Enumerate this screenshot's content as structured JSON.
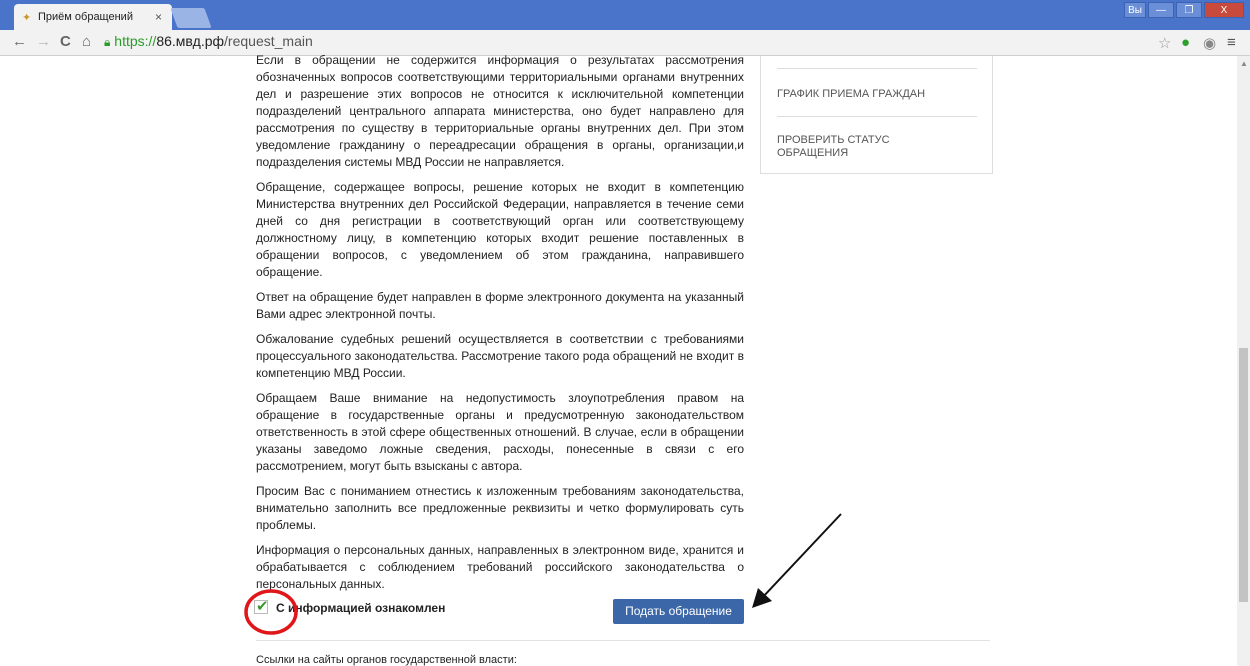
{
  "browser": {
    "tab_title": "Приём обращений",
    "tab_close": "×",
    "url_https": "https://",
    "url_host": "86.мвд.рф",
    "url_path": "/request_main",
    "window_user": "Вы",
    "minimize": "—",
    "restore": "❐",
    "close": "X"
  },
  "sidebar": {
    "link_schedule": "ГРАФИК ПРИЕМА ГРАЖДАН",
    "link_status_1": "ПРОВЕРИТЬ СТАТУС",
    "link_status_2": "ОБРАЩЕНИЯ"
  },
  "content": {
    "p1": "Если в обращении не содержится информация о результатах рассмотрения обозначенных вопросов соответствующими территориальными органами внутренних дел и разрешение этих вопросов не относится к исключительной компетенции подразделений центрального аппарата министерства, оно будет направлено для рассмотрения по существу в территориальные органы внутренних дел. При этом уведомление гражданину о переадресации обращения в органы, организации,и подразделения системы МВД России не направляется.",
    "p2": "Обращение, содержащее вопросы, решение которых не входит в компетенцию Министерства внутренних дел Российской Федерации, направляется в течение семи дней со дня регистрации в соответствующий орган или соответствующему должностному лицу, в компетенцию которых входит решение поставленных в обращении вопросов, с уведомлением об этом гражданина, направившего обращение.",
    "p3": "Ответ на обращение будет направлен в форме электронного документа на указанный Вами адрес электронной почты.",
    "p4": "Обжалование судебных решений осуществляется в соответствии с требованиями процессуального законодательства. Рассмотрение такого рода обращений не входит в компетенцию МВД России.",
    "p5": "Обращаем Ваше внимание на недопустимость злоупотребления правом на обращение в государственные органы и предусмотренную законодательством ответственность в этой сфере общественных отношений. В случае, если в обращении указаны заведомо ложные сведения, расходы, понесенные в связи с его рассмотрением, могут быть взысканы с автора.",
    "p6": "Просим Вас с пониманием отнестись к изложенным требованиям законодательства, внимательно заполнить все предложенные реквизиты и четко формулировать суть проблемы.",
    "p7": "Информация о персональных данных, направленных в электронном виде, хранится и обрабатывается с соблюдением требований российского законодательства о персональных данных."
  },
  "form": {
    "consent_label": "С информацией ознакомлен",
    "consent_checked": true,
    "submit_label": "Подать обращение"
  },
  "footer": {
    "links_heading": "Ссылки на сайты органов государственной власти:"
  },
  "colors": {
    "accent": "#3b67a8",
    "annotation": "#e0161b",
    "check": "#3a9a2d"
  }
}
